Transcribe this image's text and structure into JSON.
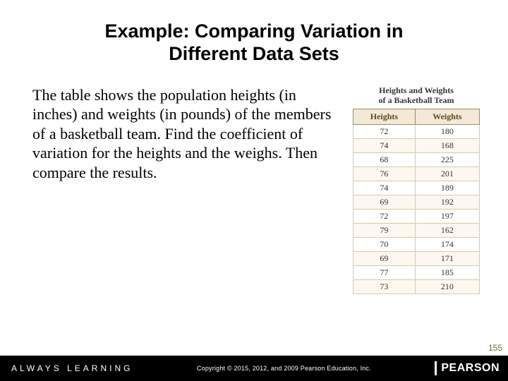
{
  "title_line1": "Example: Comparing Variation in",
  "title_line2": "Different Data Sets",
  "body": "The table shows the population heights (in inches) and weights (in pounds) of the members of a basketball team. Find the coefficient of variation for the heights and the weighs. Then compare the results.",
  "table": {
    "caption_line1": "Heights and Weights",
    "caption_line2": "of a Basketball Team",
    "col1": "Heights",
    "col2": "Weights",
    "rows": [
      {
        "h": "72",
        "w": "180"
      },
      {
        "h": "74",
        "w": "168"
      },
      {
        "h": "68",
        "w": "225"
      },
      {
        "h": "76",
        "w": "201"
      },
      {
        "h": "74",
        "w": "189"
      },
      {
        "h": "69",
        "w": "192"
      },
      {
        "h": "72",
        "w": "197"
      },
      {
        "h": "79",
        "w": "162"
      },
      {
        "h": "70",
        "w": "174"
      },
      {
        "h": "69",
        "w": "171"
      },
      {
        "h": "77",
        "w": "185"
      },
      {
        "h": "73",
        "w": "210"
      }
    ]
  },
  "footer": {
    "always": "ALWAYS LEARNING",
    "copyright": "Copyright © 2015, 2012, and 2009 Pearson Education, Inc.",
    "brand": "PEARSON"
  },
  "page_number": "155",
  "chart_data": {
    "type": "table",
    "title": "Heights and Weights of a Basketball Team",
    "columns": [
      "Heights",
      "Weights"
    ],
    "data": [
      [
        72,
        180
      ],
      [
        74,
        168
      ],
      [
        68,
        225
      ],
      [
        76,
        201
      ],
      [
        74,
        189
      ],
      [
        69,
        192
      ],
      [
        72,
        197
      ],
      [
        79,
        162
      ],
      [
        70,
        174
      ],
      [
        69,
        171
      ],
      [
        77,
        185
      ],
      [
        73,
        210
      ]
    ]
  }
}
